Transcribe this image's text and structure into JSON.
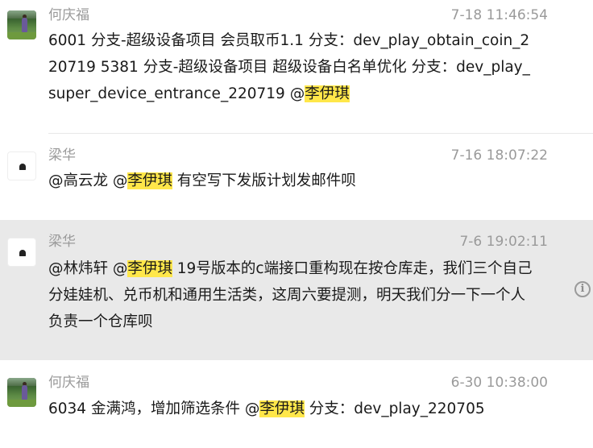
{
  "messages": [
    {
      "sender": "何庆福",
      "time": "7-18 11:46:54",
      "avatar": "photo-avatar",
      "body_before": " 6001 分支-超级设备项目 会员取币1.1 分支：dev_play_obtain_coin_220719 5381 分支-超级设备项目 超级设备白名单优化 分支：dev_play_super_device_entrance_220719 @",
      "mention": "李伊琪",
      "body_after": ""
    },
    {
      "sender": "梁华",
      "time": "7-16 18:07:22",
      "avatar": "plain-avatar",
      "body_before": "@高云龙 @",
      "mention": "李伊琪",
      "body_after": " 有空写下发版计划发邮件呗"
    },
    {
      "sender": "梁华",
      "time": "7-6 19:02:11",
      "avatar": "plain-avatar",
      "body_before": "@林炜轩 @",
      "mention": "李伊琪",
      "body_after": " 19号版本的c端接口重构现在按仓库走，我们三个自己分娃娃机、兑币机和通用生活类，这周六要提测，明天我们分一下一个人负责一个仓库呗"
    },
    {
      "sender": "何庆福",
      "time": "6-30 10:38:00",
      "avatar": "photo-avatar",
      "body_before": "6034 金满鸿，增加筛选条件 @",
      "mention": "李伊琪",
      "body_after": " 分支：dev_play_220705"
    }
  ],
  "icons": {
    "info": "info-icon",
    "info_glyph": "i"
  },
  "colors": {
    "mention_highlight": "#ffe74a",
    "hover_row": "#e9e9e9",
    "meta_text": "#9a9a9a"
  }
}
